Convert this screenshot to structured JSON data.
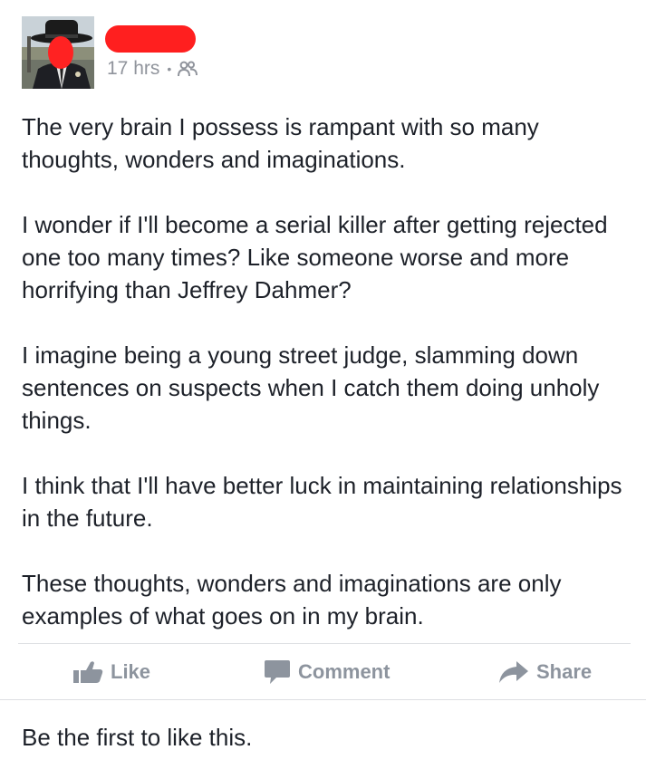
{
  "post": {
    "timestamp": "17 hrs",
    "separator": "•",
    "audience_icon": "friends-icon",
    "author_name_redacted_color": "#ff1f1f",
    "paragraphs": [
      "The very brain I possess is rampant with so many thoughts, wonders and imaginations.",
      "I wonder if I'll become a serial killer after getting rejected one too many times?  Like someone worse and more horrifying than Jeffrey Dahmer?",
      "I imagine being a young street judge, slamming down sentences on suspects when I catch them doing unholy things.",
      "I think that I'll have better luck in maintaining relationships in the future.",
      "These thoughts, wonders and imaginations are only examples of what goes on in my brain."
    ]
  },
  "actions": {
    "like_label": "Like",
    "like_icon": "thumbs-up-icon",
    "comment_label": "Comment",
    "comment_icon": "speech-bubble-icon",
    "share_label": "Share",
    "share_icon": "share-arrow-icon"
  },
  "footer": {
    "likes_summary": "Be the first to like this."
  },
  "colors": {
    "text": "#1d2129",
    "meta": "#90949c",
    "action": "#8d949e",
    "divider": "#dddfe2",
    "redaction": "#ff1f1f"
  }
}
